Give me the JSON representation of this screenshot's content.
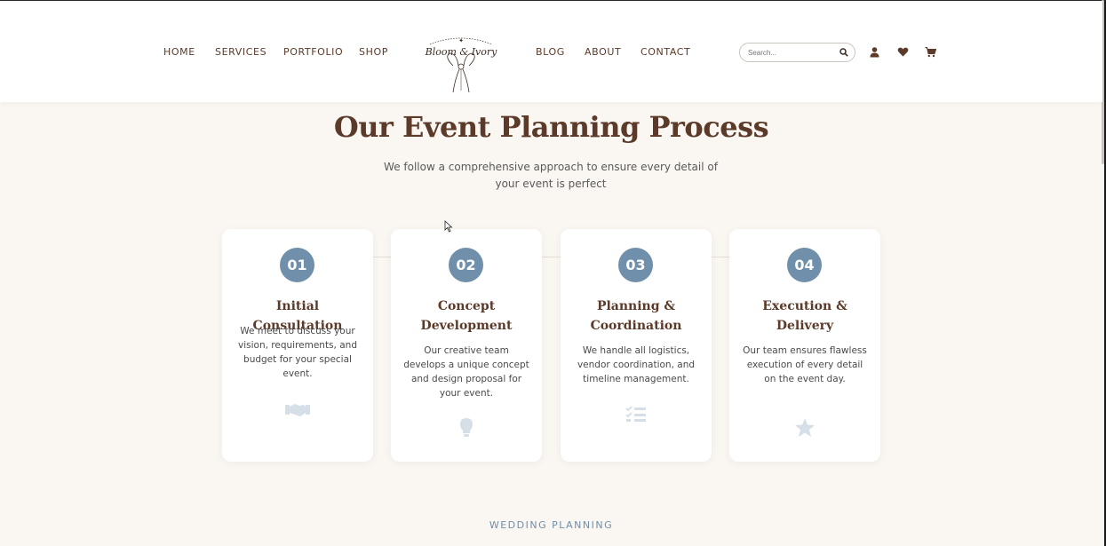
{
  "header": {
    "nav_left": [
      "HOME",
      "SERVICES",
      "PORTFOLIO",
      "SHOP"
    ],
    "nav_right": [
      "BLOG",
      "ABOUT",
      "CONTACT"
    ],
    "logo_text": "Bloom & Ivory",
    "search_placeholder": "Search...",
    "icons": [
      "user-icon",
      "heart-icon",
      "cart-icon"
    ]
  },
  "main": {
    "title": "Our Event Planning Process",
    "subtitle": "We follow a comprehensive approach to ensure every detail of your event is perfect",
    "steps": [
      {
        "number": "01",
        "title": "Initial Consultation",
        "description": "We meet to discuss your vision, requirements, and budget for your special event.",
        "icon": "handshake-icon"
      },
      {
        "number": "02",
        "title": "Concept Development",
        "description": "Our creative team develops a unique concept and design proposal for your event.",
        "icon": "lightbulb-icon"
      },
      {
        "number": "03",
        "title": "Planning & Coordination",
        "description": "We handle all logistics, vendor coordination, and timeline management.",
        "icon": "tasks-icon"
      },
      {
        "number": "04",
        "title": "Execution & Delivery",
        "description": "Our team ensures flawless execution of every detail on the event day.",
        "icon": "star-icon"
      }
    ],
    "next_section_label": "WEDDING PLANNING"
  },
  "colors": {
    "background": "#faf6f2",
    "brown": "#5b3a29",
    "accent_blue": "#6f8fab",
    "icon_light": "#d6dfe8"
  }
}
